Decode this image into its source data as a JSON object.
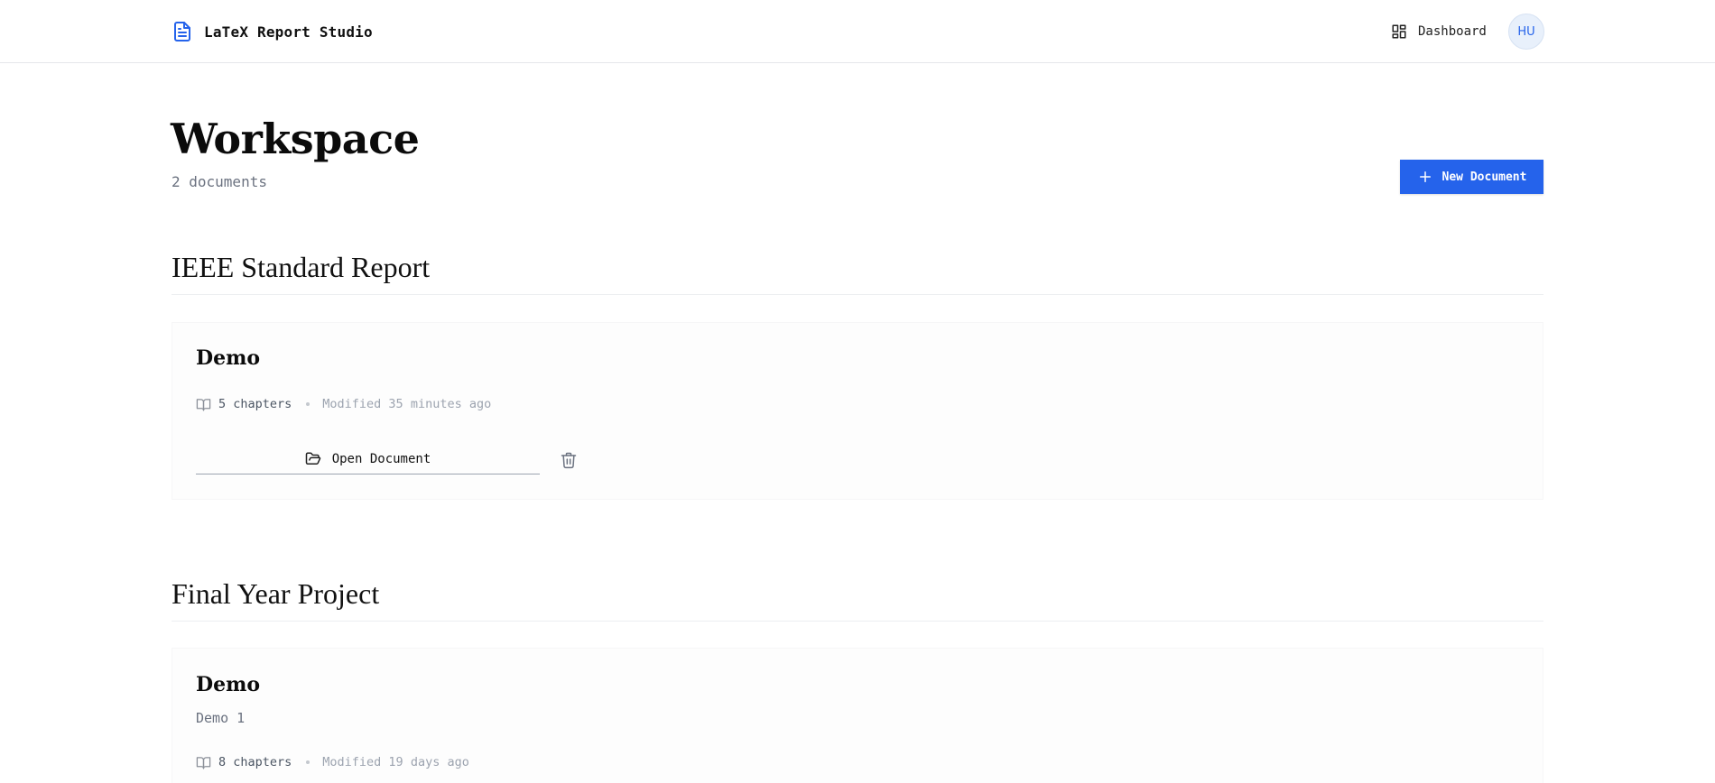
{
  "header": {
    "app_title": "LaTeX Report Studio",
    "app_icon": "document-icon",
    "dashboard_label": "Dashboard",
    "dashboard_icon": "dashboard-grid-icon",
    "avatar_initials": "HU"
  },
  "page": {
    "title": "Workspace",
    "doc_count": "2 documents",
    "new_document_label": "New Document",
    "new_document_icon": "plus-icon"
  },
  "groups": [
    {
      "title": "IEEE Standard Report",
      "documents": [
        {
          "title": "Demo",
          "chapters": "5 chapters",
          "modified": "Modified 35 minutes ago",
          "open_label": "Open Document"
        }
      ]
    },
    {
      "title": "Final Year Project",
      "documents": [
        {
          "title": "Demo",
          "description": "Demo 1",
          "chapters": "8 chapters",
          "modified": "Modified 19 days ago"
        }
      ]
    }
  ],
  "colors": {
    "accent": "#2563eb",
    "text": "#111111",
    "muted": "#6b7280",
    "faint": "#9ca3af",
    "avatar_bg": "#e8f0fb"
  }
}
